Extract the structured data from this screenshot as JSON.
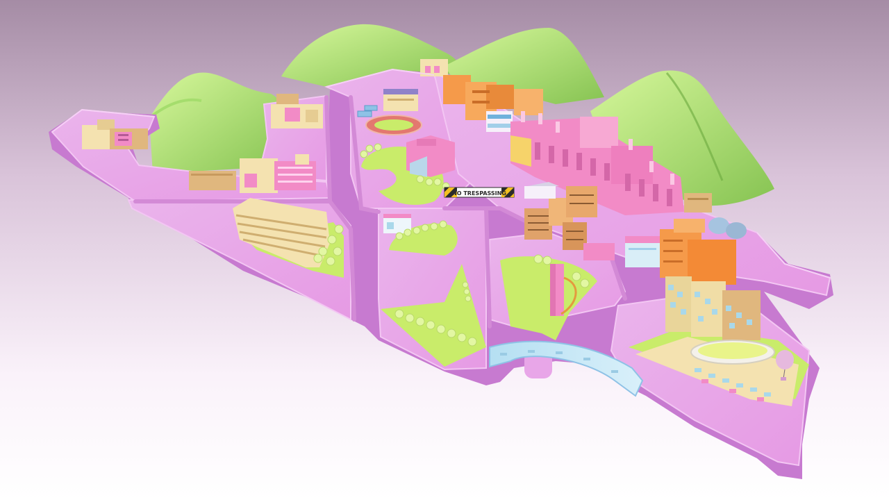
{
  "scene": {
    "colors": {
      "background_top": "#a58ca5",
      "background_mid": "#e7d4e7",
      "background_bottom": "#ffffff",
      "platform_top": "#e8a6e8",
      "platform_side": "#c97fcf",
      "platform_dark": "#b56bbb",
      "grass": "#c9ec6a",
      "grass_dark": "#98c84a",
      "hill_light": "#c7f08a",
      "hill_dark": "#7fbf4c",
      "building_pink": "#f28bc6",
      "building_orange": "#f59a4a",
      "building_cream": "#f4e2b0",
      "building_tan": "#e0b77e",
      "building_blue": "#a9d8ea",
      "tree": "#e3f7a3",
      "warning_yellow": "#f2c021",
      "warning_black": "#2b2b2b"
    }
  },
  "labels": {
    "barrier_sign": "NO TRESPASSING"
  }
}
